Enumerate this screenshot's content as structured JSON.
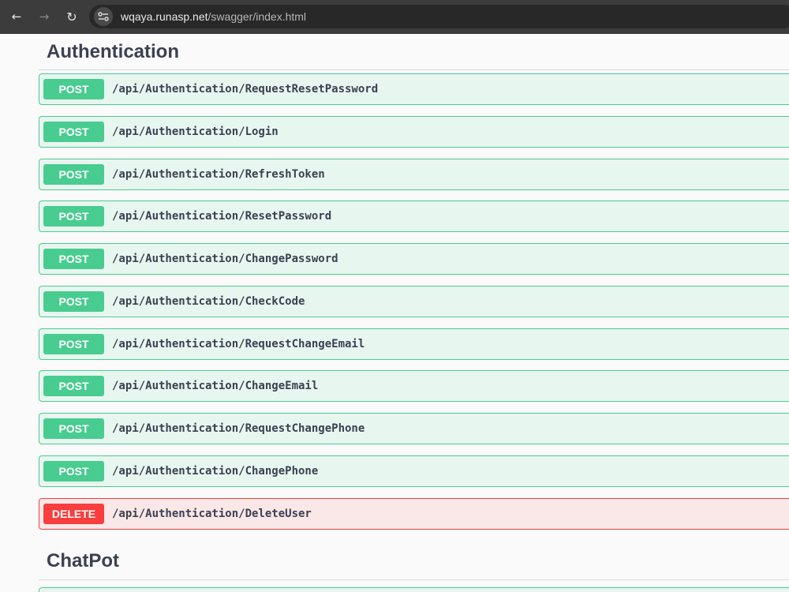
{
  "browser": {
    "back_icon": "arrow-left-icon",
    "forward_icon": "arrow-right-icon",
    "reload_icon": "reload-icon",
    "site_info_icon": "tune-icon",
    "url_host": "wqaya.runasp.net",
    "url_path": "/swagger/index.html"
  },
  "colors": {
    "post": "#49cc90",
    "post_bg": "#e8f6f0",
    "delete": "#f93e3e",
    "delete_bg": "#fae7e7",
    "title_text": "#3b4151"
  },
  "sections": [
    {
      "title": "Authentication",
      "operations": [
        {
          "method": "POST",
          "path": "/api/Authentication/RequestResetPassword"
        },
        {
          "method": "POST",
          "path": "/api/Authentication/Login"
        },
        {
          "method": "POST",
          "path": "/api/Authentication/RefreshToken"
        },
        {
          "method": "POST",
          "path": "/api/Authentication/ResetPassword"
        },
        {
          "method": "POST",
          "path": "/api/Authentication/ChangePassword"
        },
        {
          "method": "POST",
          "path": "/api/Authentication/CheckCode"
        },
        {
          "method": "POST",
          "path": "/api/Authentication/RequestChangeEmail"
        },
        {
          "method": "POST",
          "path": "/api/Authentication/ChangeEmail"
        },
        {
          "method": "POST",
          "path": "/api/Authentication/RequestChangePhone"
        },
        {
          "method": "POST",
          "path": "/api/Authentication/ChangePhone"
        },
        {
          "method": "DELETE",
          "path": "/api/Authentication/DeleteUser"
        }
      ]
    },
    {
      "title": "ChatPot"
    }
  ]
}
